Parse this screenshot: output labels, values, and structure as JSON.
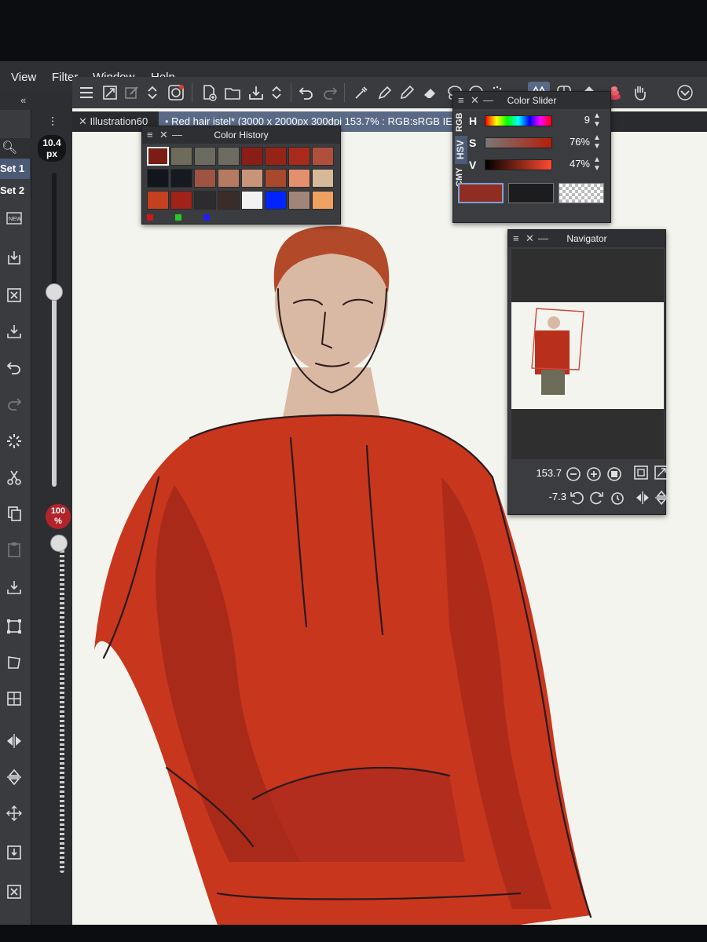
{
  "menu": {
    "items": [
      {
        "label": "View"
      },
      {
        "label": "Filter"
      },
      {
        "label": "Window"
      },
      {
        "label": "Help"
      }
    ]
  },
  "tabs": {
    "first": "Illustration60",
    "second": "Red hair istel* (3000 x 2000px 300dpi 153.7% : RGB:sRGB IE"
  },
  "brush": {
    "size_value": "10.4",
    "size_unit": "px",
    "size_level": 0.62,
    "opacity_value": "100",
    "opacity_unit": "%",
    "opacity_level": 1.0
  },
  "sets": {
    "set1": "Set 1",
    "set2": "Set 2"
  },
  "color_history": {
    "title": "Color History",
    "swatches": [
      "#7a1d14",
      "#6e6b5c",
      "#6b6a60",
      "#6e6c60",
      "#8a1e16",
      "#962318",
      "#a82a1c",
      "#b0503c",
      "#12161c",
      "#161a20",
      "#9e5440",
      "#b67a62",
      "#c8957a",
      "#a8482c",
      "#e4906c",
      "#d7b99a",
      "#c4401e",
      "#a02218",
      "#2c2c2e",
      "#3a2c28",
      "#f2f2f2",
      "#0024ff",
      "#a08678",
      "#f0a060"
    ],
    "mini": [
      "#d01818",
      "#22cc22",
      "#2020ee"
    ]
  },
  "color_slider": {
    "title": "Color Slider",
    "modes": [
      "RGB",
      "HSV",
      "CMY"
    ],
    "h": {
      "label": "H",
      "value": "9"
    },
    "s": {
      "label": "S",
      "value": "76%"
    },
    "v": {
      "label": "V",
      "value": "47%"
    },
    "main_color": "#8f2d22",
    "sub_color": "#1c1c1e"
  },
  "navigator": {
    "title": "Navigator",
    "zoom": "153.7",
    "rotation": "-7.3"
  },
  "colors": {
    "hoodie": "#c8361e",
    "hoodie_shadow": "#9c2518",
    "skin": "#d9b9a4",
    "hair": "#b24a2a",
    "pants": "#6e6a58"
  }
}
